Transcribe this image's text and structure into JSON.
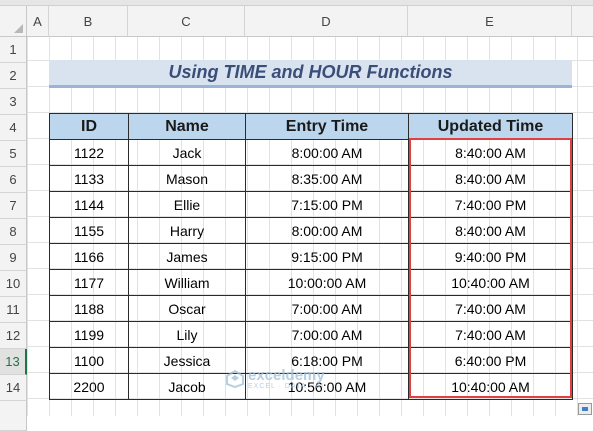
{
  "column_headers": [
    "A",
    "B",
    "C",
    "D",
    "E"
  ],
  "row_headers": [
    "1",
    "2",
    "3",
    "4",
    "5",
    "6",
    "7",
    "8",
    "9",
    "10",
    "11",
    "12",
    "13",
    "14"
  ],
  "title": "Using TIME and HOUR Functions",
  "table": {
    "headers": [
      "ID",
      "Name",
      "Entry Time",
      "Updated Time"
    ],
    "rows": [
      [
        "1122",
        "Jack",
        "8:00:00 AM",
        "8:40:00 AM"
      ],
      [
        "1133",
        "Mason",
        "8:35:00 AM",
        "8:40:00 AM"
      ],
      [
        "1144",
        "Ellie",
        "7:15:00 PM",
        "7:40:00 PM"
      ],
      [
        "1155",
        "Harry",
        "8:00:00 AM",
        "8:40:00 AM"
      ],
      [
        "1166",
        "James",
        "9:15:00 PM",
        "9:40:00 PM"
      ],
      [
        "1177",
        "William",
        "10:00:00 AM",
        "10:40:00 AM"
      ],
      [
        "1188",
        "Oscar",
        "7:00:00 AM",
        "7:40:00 AM"
      ],
      [
        "1199",
        "Lily",
        "7:00:00 AM",
        "7:40:00 AM"
      ],
      [
        "1100",
        "Jessica",
        "6:18:00 PM",
        "6:40:00 PM"
      ],
      [
        "2200",
        "Jacob",
        "10:56:00 AM",
        "10:40:00 AM"
      ]
    ]
  },
  "watermark": {
    "name": "exceldemy",
    "tagline": "EXCEL · DATA · BI"
  },
  "colors": {
    "title_fill": "#d9e3f0",
    "title_text": "#3b4e78",
    "header_fill": "#bcd6ee",
    "highlight_border": "#e0403f",
    "selected_row_header": "#217346"
  }
}
